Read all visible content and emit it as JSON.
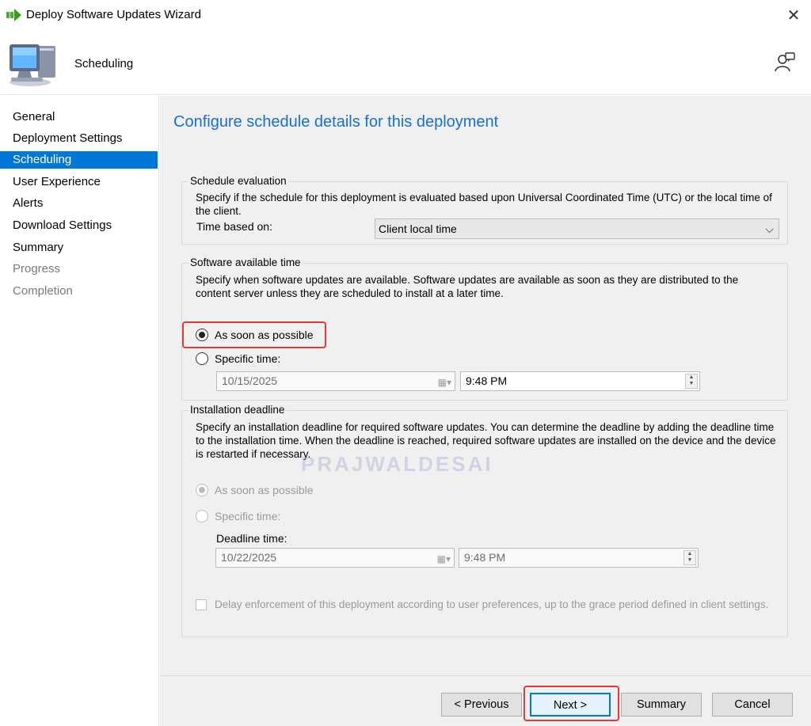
{
  "window": {
    "title": "Deploy Software Updates Wizard"
  },
  "header": {
    "title": "Scheduling"
  },
  "sidebar": {
    "items": [
      {
        "label": "General",
        "state": "normal"
      },
      {
        "label": "Deployment Settings",
        "state": "normal"
      },
      {
        "label": "Scheduling",
        "state": "active"
      },
      {
        "label": "User Experience",
        "state": "normal"
      },
      {
        "label": "Alerts",
        "state": "normal"
      },
      {
        "label": "Download Settings",
        "state": "normal"
      },
      {
        "label": "Summary",
        "state": "normal"
      },
      {
        "label": "Progress",
        "state": "disabled"
      },
      {
        "label": "Completion",
        "state": "disabled"
      }
    ]
  },
  "main": {
    "heading": "Configure schedule details for this deployment",
    "schedule_evaluation": {
      "title": "Schedule evaluation",
      "description": "Specify if the schedule for this deployment is evaluated based upon Universal Coordinated Time (UTC) or the local time of the client.",
      "time_based_label": "Time based on:",
      "time_based_value": "Client local time"
    },
    "available_time": {
      "title": "Software available time",
      "description": "Specify when software updates are available. Software updates are available as soon as they are distributed to the content server unless they are scheduled to install at a later time.",
      "option_asap": "As soon as possible",
      "option_specific": "Specific time:",
      "date": "10/15/2025",
      "time": "9:48 PM"
    },
    "deadline": {
      "title": "Installation deadline",
      "description": "Specify an installation deadline for required software updates. You can determine the deadline by adding the deadline time to the installation time. When the deadline is reached, required software updates are installed on the device and the device is restarted if necessary.",
      "option_asap": "As soon as possible",
      "option_specific": "Specific time:",
      "deadline_label": "Deadline time:",
      "date": "10/22/2025",
      "time": "9:48 PM",
      "delay_checkbox": "Delay enforcement of this deployment according to user preferences, up to the grace period defined in client settings."
    },
    "watermark": "PRAJWALDESAI"
  },
  "footer": {
    "previous": "< Previous",
    "next": "Next >",
    "summary": "Summary",
    "cancel": "Cancel"
  },
  "colors": {
    "accent": "#0078d7",
    "heading": "#1a6fd0",
    "highlight": "#e03a3a"
  }
}
